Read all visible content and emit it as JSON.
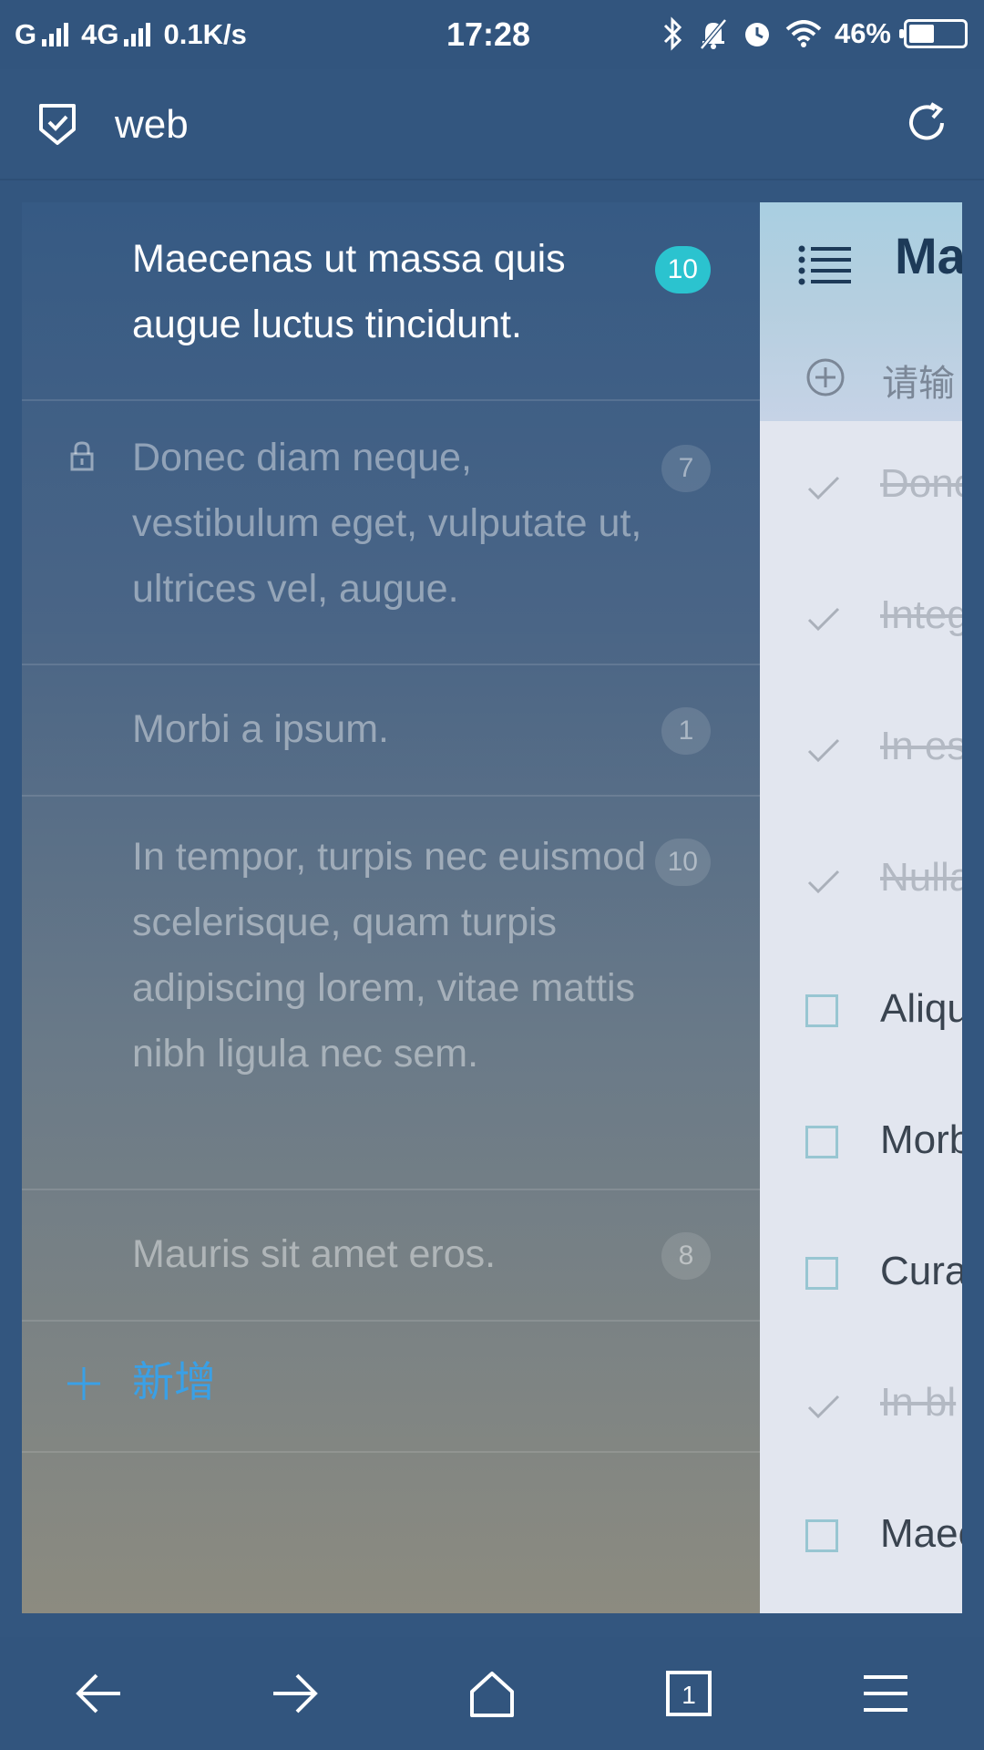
{
  "status_bar": {
    "carrier": "G",
    "network": "4G",
    "speed": "0.1K/s",
    "time": "17:28",
    "battery": "46%",
    "battery_level": 0.46
  },
  "app_bar": {
    "title": "web"
  },
  "drawer": {
    "lists": [
      {
        "label": "Maecenas ut massa quis augue luctus tincidunt.",
        "count": "10",
        "active": true,
        "locked": false
      },
      {
        "label": "Donec diam neque, vestibulum eget, vulputate ut, ultrices vel, augue.",
        "count": "7",
        "active": false,
        "locked": true
      },
      {
        "label": "Morbi a ipsum.",
        "count": "1",
        "active": false,
        "locked": false
      },
      {
        "label": "In tempor, turpis nec euismod scelerisque, quam turpis adipiscing lorem, vitae mattis nibh ligula nec sem.",
        "count": "10",
        "active": false,
        "locked": false
      },
      {
        "label": "Mauris sit amet eros.",
        "count": "8",
        "active": false,
        "locked": false
      }
    ],
    "add_label": "新增"
  },
  "list_panel": {
    "title": "Ma",
    "add_placeholder": "请输",
    "tasks": [
      {
        "text": "Donc",
        "done": true
      },
      {
        "text": "Integ",
        "done": true
      },
      {
        "text": "In es",
        "done": true
      },
      {
        "text": "Nulla",
        "done": true
      },
      {
        "text": "Aliqu",
        "done": false
      },
      {
        "text": "Morb",
        "done": false
      },
      {
        "text": "Cura",
        "done": false
      },
      {
        "text": "In bl",
        "done": true
      },
      {
        "text": "Maec",
        "done": false
      }
    ]
  },
  "colors": {
    "app_bar": "#33567f",
    "badge_active": "#2bc3cf",
    "add_accent": "#3aa0e6"
  }
}
